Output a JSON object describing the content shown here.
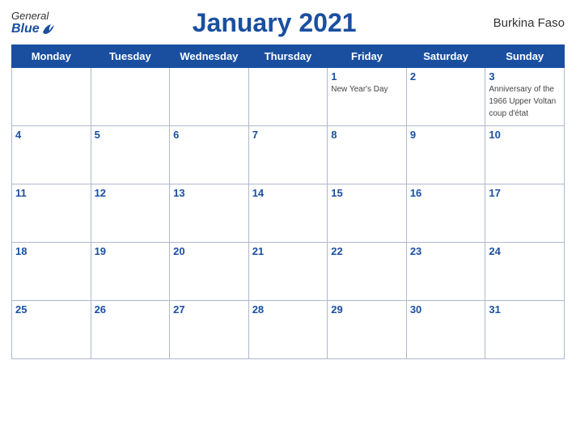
{
  "header": {
    "logo_general": "General",
    "logo_blue": "Blue",
    "title": "January 2021",
    "country": "Burkina Faso"
  },
  "weekdays": [
    "Monday",
    "Tuesday",
    "Wednesday",
    "Thursday",
    "Friday",
    "Saturday",
    "Sunday"
  ],
  "weeks": [
    [
      {
        "day": "",
        "event": ""
      },
      {
        "day": "",
        "event": ""
      },
      {
        "day": "",
        "event": ""
      },
      {
        "day": "",
        "event": ""
      },
      {
        "day": "1",
        "event": "New Year's Day"
      },
      {
        "day": "2",
        "event": ""
      },
      {
        "day": "3",
        "event": "Anniversary of the 1966 Upper Voltan coup d'état"
      }
    ],
    [
      {
        "day": "4",
        "event": ""
      },
      {
        "day": "5",
        "event": ""
      },
      {
        "day": "6",
        "event": ""
      },
      {
        "day": "7",
        "event": ""
      },
      {
        "day": "8",
        "event": ""
      },
      {
        "day": "9",
        "event": ""
      },
      {
        "day": "10",
        "event": ""
      }
    ],
    [
      {
        "day": "11",
        "event": ""
      },
      {
        "day": "12",
        "event": ""
      },
      {
        "day": "13",
        "event": ""
      },
      {
        "day": "14",
        "event": ""
      },
      {
        "day": "15",
        "event": ""
      },
      {
        "day": "16",
        "event": ""
      },
      {
        "day": "17",
        "event": ""
      }
    ],
    [
      {
        "day": "18",
        "event": ""
      },
      {
        "day": "19",
        "event": ""
      },
      {
        "day": "20",
        "event": ""
      },
      {
        "day": "21",
        "event": ""
      },
      {
        "day": "22",
        "event": ""
      },
      {
        "day": "23",
        "event": ""
      },
      {
        "day": "24",
        "event": ""
      }
    ],
    [
      {
        "day": "25",
        "event": ""
      },
      {
        "day": "26",
        "event": ""
      },
      {
        "day": "27",
        "event": ""
      },
      {
        "day": "28",
        "event": ""
      },
      {
        "day": "29",
        "event": ""
      },
      {
        "day": "30",
        "event": ""
      },
      {
        "day": "31",
        "event": ""
      }
    ]
  ]
}
